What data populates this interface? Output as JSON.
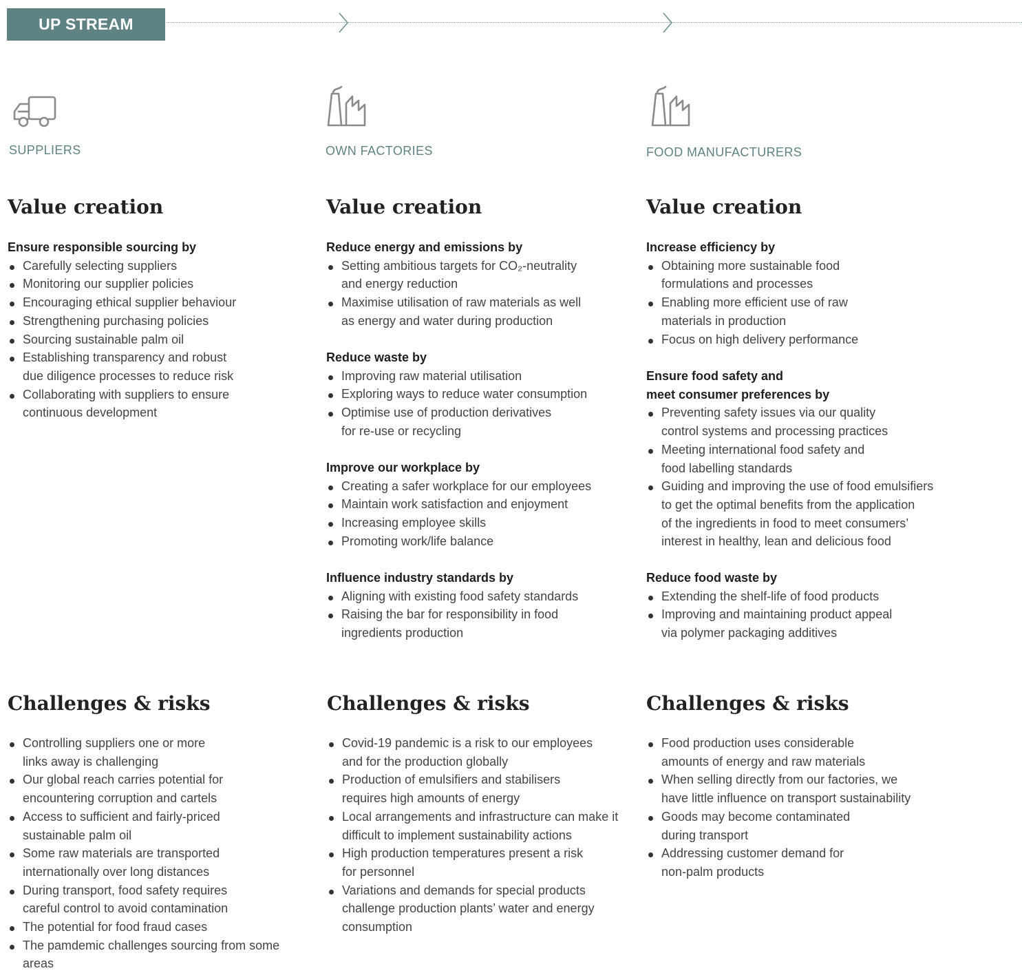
{
  "banner": {
    "label": "UP STREAM",
    "color": "#5f8283"
  },
  "columns": [
    {
      "label": "SUPPLIERS",
      "icon": "truck-icon",
      "value_title": "Value creation",
      "groups": [
        {
          "title": "Ensure responsible sourcing by",
          "items": [
            "Carefully selecting suppliers",
            "Monitoring our supplier policies",
            "Encouraging ethical supplier behaviour",
            "Strengthening purchasing policies",
            "Sourcing sustainable palm oil",
            "Establishing transparency and robust\ndue diligence processes to reduce risk",
            "Collaborating with suppliers to ensure\ncontinuous development"
          ]
        }
      ],
      "risks_title": "Challenges & risks",
      "risks": [
        "Controlling suppliers one or more\nlinks away is challenging",
        "Our global reach carries potential for\nencountering corruption and cartels",
        "Access to sufficient and fairly-priced\nsustainable palm oil",
        "Some raw materials are transported\ninternationally over long distances",
        "During transport, food safety requires\ncareful control to avoid contamination",
        "The potential for food fraud cases",
        "The pamdemic challenges sourcing from some\nareas"
      ]
    },
    {
      "label": "OWN FACTORIES",
      "icon": "factory-icon",
      "value_title": "Value creation",
      "groups": [
        {
          "title": "Reduce energy and emissions by",
          "items": [
            "Setting ambitious targets for CO₂-neutrality\nand energy reduction",
            "Maximise utilisation of raw materials as well\nas energy and water during production"
          ]
        },
        {
          "title": "Reduce waste by",
          "items": [
            "Improving raw material utilisation",
            "Exploring ways to reduce water consumption",
            "Optimise use of production derivatives\nfor re-use or recycling"
          ]
        },
        {
          "title": "Improve our workplace by",
          "items": [
            "Creating a safer workplace for our employees",
            "Maintain work satisfaction and enjoyment",
            "Increasing employee skills",
            "Promoting work/life balance"
          ]
        },
        {
          "title": "Influence industry standards by",
          "items": [
            "Aligning with existing food safety standards",
            "Raising the bar for responsibility in food\ningredients production"
          ]
        }
      ],
      "risks_title": "Challenges & risks",
      "risks": [
        "Covid-19 pandemic is a risk to our employees\nand for the production globally",
        "Production of emulsifiers and stabilisers\nrequires high amounts of energy",
        "Local arrangements and infrastructure can make it\ndifficult to implement sustainability actions",
        "High production temperatures present a risk\nfor personnel",
        "Variations and demands for special products\nchallenge production plants’ water and energy\nconsumption"
      ]
    },
    {
      "label": "FOOD MANUFACTURERS",
      "icon": "factory-icon",
      "value_title": "Value creation",
      "groups": [
        {
          "title": "Increase efficiency by",
          "items": [
            "Obtaining more sustainable food\nformulations and processes",
            "Enabling more efficient use of raw\nmaterials in production",
            "Focus on high delivery performance"
          ]
        },
        {
          "title": "Ensure food safety and\nmeet consumer preferences by",
          "items": [
            "Preventing safety issues via our quality\ncontrol systems and processing practices",
            "Meeting international food safety and\nfood labelling standards",
            "Guiding and improving the use of food emulsifiers\nto get the optimal benefits from the application\nof the ingredients in food to meet consumers’\ninterest in healthy, lean and delicious food"
          ]
        },
        {
          "title": "Reduce food waste by",
          "items": [
            "Extending the shelf-life of food products",
            "Improving and maintaining product appeal\nvia polymer packaging additives"
          ]
        }
      ],
      "risks_title": "Challenges & risks",
      "risks": [
        "Food production uses considerable\namounts of energy and raw materials",
        "When selling directly from our factories, we\nhave little influence on transport sustainability",
        "Goods may become contaminated\nduring transport",
        "Addressing customer demand for\nnon-palm products"
      ]
    }
  ]
}
